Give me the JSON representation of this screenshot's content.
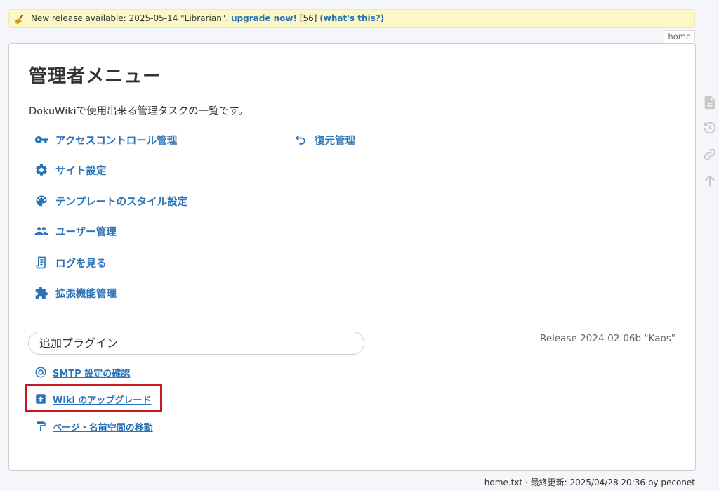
{
  "notice": {
    "text": "New release available: 2025-05-14 \"Librarian\".",
    "upgrade_link": "upgrade now!",
    "count": "[56]",
    "whats_this_link": "(what's this?)"
  },
  "page_id_tab": "home",
  "admin": {
    "title": "管理者メニュー",
    "intro": "DokuWikiで使用出来る管理タスクの一覧です。",
    "menu_left": [
      {
        "label": "アクセスコントロール管理",
        "icon": "key-icon"
      },
      {
        "label": "サイト設定",
        "icon": "gear-icon"
      },
      {
        "label": "テンプレートのスタイル設定",
        "icon": "palette-icon"
      },
      {
        "label": "ユーザー管理",
        "icon": "users-icon"
      },
      {
        "label": "ログを見る",
        "icon": "scroll-icon"
      },
      {
        "label": "拡張機能管理",
        "icon": "puzzle-icon"
      }
    ],
    "menu_right": [
      {
        "label": "復元管理",
        "icon": "undo-icon"
      }
    ],
    "additional_plugins_heading": "追加プラグイン",
    "release": "Release 2024-02-06b \"Kaos\"",
    "plugins": [
      {
        "label": "SMTP 設定の確認",
        "icon": "at-sign-icon"
      },
      {
        "label": "Wiki のアップグレード",
        "icon": "upgrade-icon"
      },
      {
        "label": "ページ・名前空間の移動",
        "icon": "paint-roller-icon"
      }
    ]
  },
  "sidebar_tools": [
    "page-icon",
    "history-icon",
    "link-icon",
    "arrow-up-icon"
  ],
  "footer": "home.txt · 最終更新: 2025/04/28 20:36 by peconet",
  "colors": {
    "link": "#2b73b7",
    "notice_bg": "#fbf8c6",
    "highlight_border": "#c41a1f",
    "tool_icon": "#cccccc"
  }
}
